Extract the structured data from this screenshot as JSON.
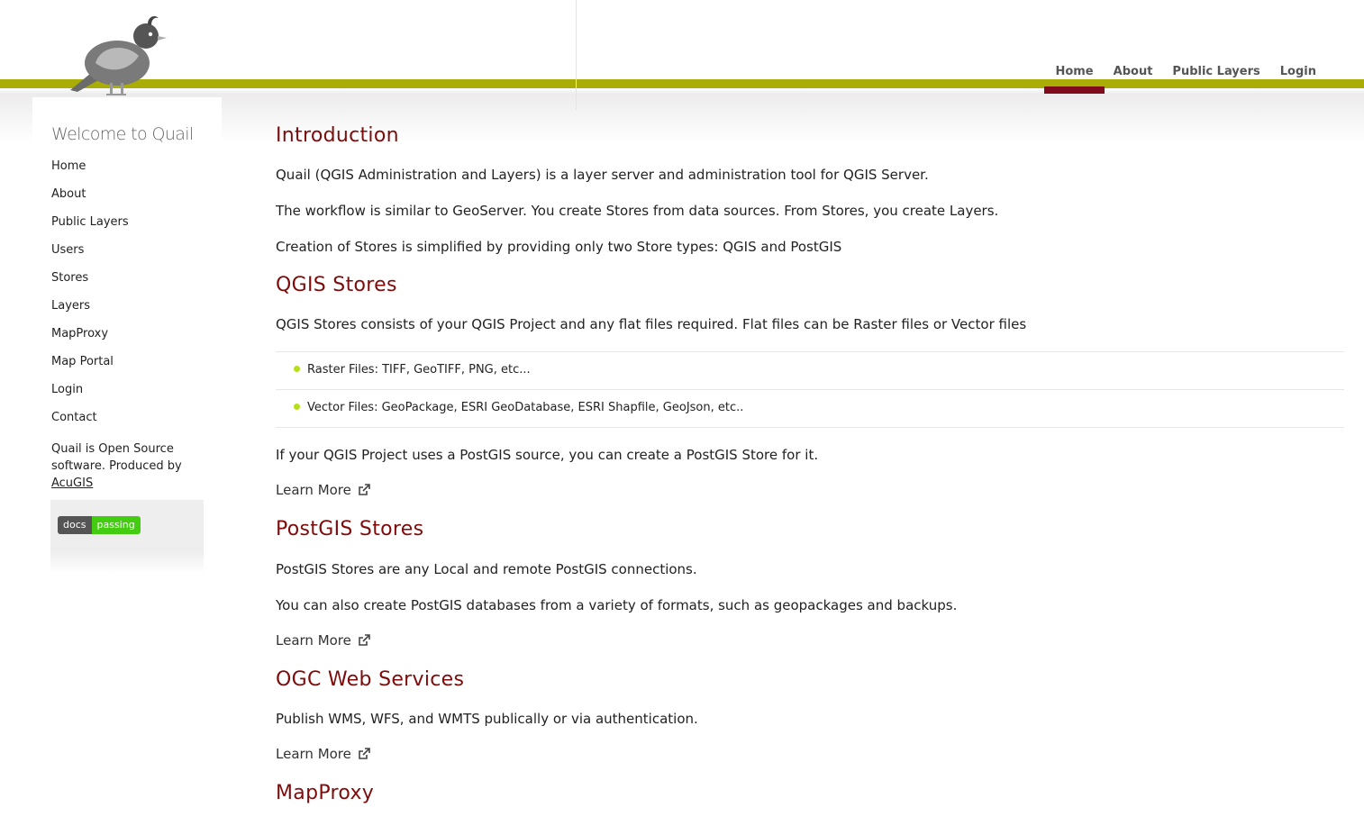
{
  "header": {
    "logo_icon": "quail-bird-logo",
    "band_color": "#a9ad05",
    "accent_color": "#7f0b1d",
    "nav": [
      {
        "label": "Home",
        "active": true
      },
      {
        "label": "About",
        "active": false
      },
      {
        "label": "Public Layers",
        "active": false
      },
      {
        "label": "Login",
        "active": false
      }
    ]
  },
  "sidebar": {
    "title": "Welcome to Quail",
    "items": [
      "Home",
      "About",
      "Public Layers",
      "Users",
      "Stores",
      "Layers",
      "MapProxy",
      "Map Portal",
      "Login",
      "Contact"
    ],
    "note_text": "Quail is Open Source software. Produced by",
    "note_link": "AcuGIS",
    "badge_left": "docs",
    "badge_right": "passing"
  },
  "content": {
    "intro": {
      "heading": "Introduction",
      "p1": "Quail (QGIS Administration and Layers) is a layer server and administration tool for QGIS Server.",
      "p2": "The workflow is similar to GeoServer. You create Stores from data sources. From Stores, you create Layers.",
      "p3": "Creation of Stores is simplified by providing only two Store types: QGIS and PostGIS"
    },
    "qgis": {
      "heading": "QGIS Stores",
      "p1": "QGIS Stores consists of your QGIS Project and any flat files required. Flat files can be Raster files or Vector files",
      "list": [
        "Raster Files: TIFF, GeoTIFF, PNG, etc...",
        "Vector Files: GeoPackage, ESRI GeoDatabase, ESRI Shapfile, GeoJson, etc.."
      ],
      "p2": "If your QGIS Project uses a PostGIS source, you can create a PostGIS Store for it.",
      "learn": "Learn More"
    },
    "postgis": {
      "heading": "PostGIS Stores",
      "p1": "PostGIS Stores are any Local and remote PostGIS connections.",
      "p2": "You can also create PostGIS databases from a variety of formats, such as geopackages and backups.",
      "learn": "Learn More"
    },
    "ogc": {
      "heading": "OGC Web Services",
      "p1": "Publish WMS, WFS, and WMTS publically or via authentication.",
      "learn": "Learn More"
    },
    "mapproxy": {
      "heading": "MapProxy"
    }
  }
}
